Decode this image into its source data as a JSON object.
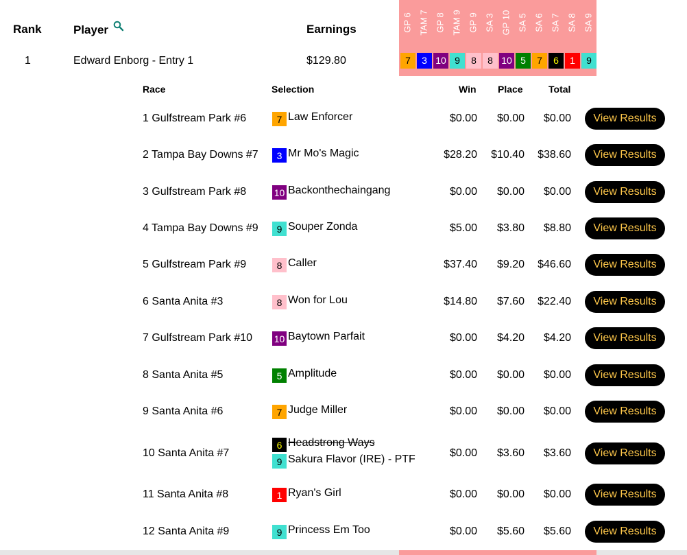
{
  "columns": {
    "rank": "Rank",
    "player": "Player",
    "earnings": "Earnings"
  },
  "search_icon": "search-icon",
  "race_headers": [
    "GP 6",
    "TAM 7",
    "GP 8",
    "TAM 9",
    "GP 9",
    "SA 3",
    "GP 10",
    "SA 5",
    "SA 6",
    "SA 7",
    "SA 8",
    "SA 9"
  ],
  "player_row": {
    "rank": "1",
    "name": "Edward Enborg - Entry 1",
    "earnings": "$129.80"
  },
  "chips": [
    {
      "num": "7",
      "bg": "#ffa500",
      "fg": "#000000"
    },
    {
      "num": "3",
      "bg": "#0000ff",
      "fg": "#ffffff"
    },
    {
      "num": "10",
      "bg": "#800080",
      "fg": "#ffffff"
    },
    {
      "num": "9",
      "bg": "#40e0d0",
      "fg": "#000000"
    },
    {
      "num": "8",
      "bg": "#ffc0cb",
      "fg": "#000000"
    },
    {
      "num": "8",
      "bg": "#ffc0cb",
      "fg": "#000000"
    },
    {
      "num": "10",
      "bg": "#800080",
      "fg": "#ffffff"
    },
    {
      "num": "5",
      "bg": "#008000",
      "fg": "#ffffff"
    },
    {
      "num": "7",
      "bg": "#ffa500",
      "fg": "#000000"
    },
    {
      "num": "6",
      "bg": "#000000",
      "fg": "#ffff00"
    },
    {
      "num": "1",
      "bg": "#ff0000",
      "fg": "#ffffff"
    },
    {
      "num": "9",
      "bg": "#40e0d0",
      "fg": "#000000"
    }
  ],
  "detail_headers": {
    "race": "Race",
    "selection": "Selection",
    "win": "Win",
    "place": "Place",
    "total": "Total"
  },
  "button_label": "View Results",
  "races": [
    {
      "race": "1 Gulfstream Park #6",
      "selections": [
        {
          "num": "7",
          "bg": "#ffa500",
          "fg": "#000000",
          "name": "Law Enforcer",
          "scratched": false
        }
      ],
      "win": "$0.00",
      "place": "$0.00",
      "total": "$0.00"
    },
    {
      "race": "2 Tampa Bay Downs #7",
      "selections": [
        {
          "num": "3",
          "bg": "#0000ff",
          "fg": "#ffffff",
          "name": "Mr Mo's Magic",
          "scratched": false
        }
      ],
      "win": "$28.20",
      "place": "$10.40",
      "total": "$38.60"
    },
    {
      "race": "3 Gulfstream Park #8",
      "selections": [
        {
          "num": "10",
          "bg": "#800080",
          "fg": "#ffffff",
          "name": "Backonthechaingang",
          "scratched": false
        }
      ],
      "win": "$0.00",
      "place": "$0.00",
      "total": "$0.00"
    },
    {
      "race": "4 Tampa Bay Downs #9",
      "selections": [
        {
          "num": "9",
          "bg": "#40e0d0",
          "fg": "#000000",
          "name": "Souper Zonda",
          "scratched": false
        }
      ],
      "win": "$5.00",
      "place": "$3.80",
      "total": "$8.80"
    },
    {
      "race": "5 Gulfstream Park #9",
      "selections": [
        {
          "num": "8",
          "bg": "#ffc0cb",
          "fg": "#000000",
          "name": "Caller",
          "scratched": false
        }
      ],
      "win": "$37.40",
      "place": "$9.20",
      "total": "$46.60"
    },
    {
      "race": "6 Santa Anita #3",
      "selections": [
        {
          "num": "8",
          "bg": "#ffc0cb",
          "fg": "#000000",
          "name": "Won for Lou",
          "scratched": false
        }
      ],
      "win": "$14.80",
      "place": "$7.60",
      "total": "$22.40"
    },
    {
      "race": "7 Gulfstream Park #10",
      "selections": [
        {
          "num": "10",
          "bg": "#800080",
          "fg": "#ffffff",
          "name": "Baytown Parfait",
          "scratched": false
        }
      ],
      "win": "$0.00",
      "place": "$4.20",
      "total": "$4.20"
    },
    {
      "race": "8 Santa Anita #5",
      "selections": [
        {
          "num": "5",
          "bg": "#008000",
          "fg": "#ffffff",
          "name": "Amplitude",
          "scratched": false
        }
      ],
      "win": "$0.00",
      "place": "$0.00",
      "total": "$0.00"
    },
    {
      "race": "9 Santa Anita #6",
      "selections": [
        {
          "num": "7",
          "bg": "#ffa500",
          "fg": "#000000",
          "name": "Judge Miller",
          "scratched": false
        }
      ],
      "win": "$0.00",
      "place": "$0.00",
      "total": "$0.00"
    },
    {
      "race": "10 Santa Anita #7",
      "selections": [
        {
          "num": "6",
          "bg": "#000000",
          "fg": "#ffff00",
          "name": "Headstrong Ways",
          "scratched": true
        },
        {
          "num": "9",
          "bg": "#40e0d0",
          "fg": "#000000",
          "name": "Sakura Flavor (IRE) - PTF",
          "scratched": false
        }
      ],
      "win": "$0.00",
      "place": "$3.60",
      "total": "$3.60"
    },
    {
      "race": "11 Santa Anita #8",
      "selections": [
        {
          "num": "1",
          "bg": "#ff0000",
          "fg": "#ffffff",
          "name": "Ryan's Girl",
          "scratched": false
        }
      ],
      "win": "$0.00",
      "place": "$0.00",
      "total": "$0.00"
    },
    {
      "race": "12 Santa Anita #9",
      "selections": [
        {
          "num": "9",
          "bg": "#40e0d0",
          "fg": "#000000",
          "name": "Princess Em Too",
          "scratched": false
        }
      ],
      "win": "$0.00",
      "place": "$5.60",
      "total": "$5.60"
    }
  ]
}
